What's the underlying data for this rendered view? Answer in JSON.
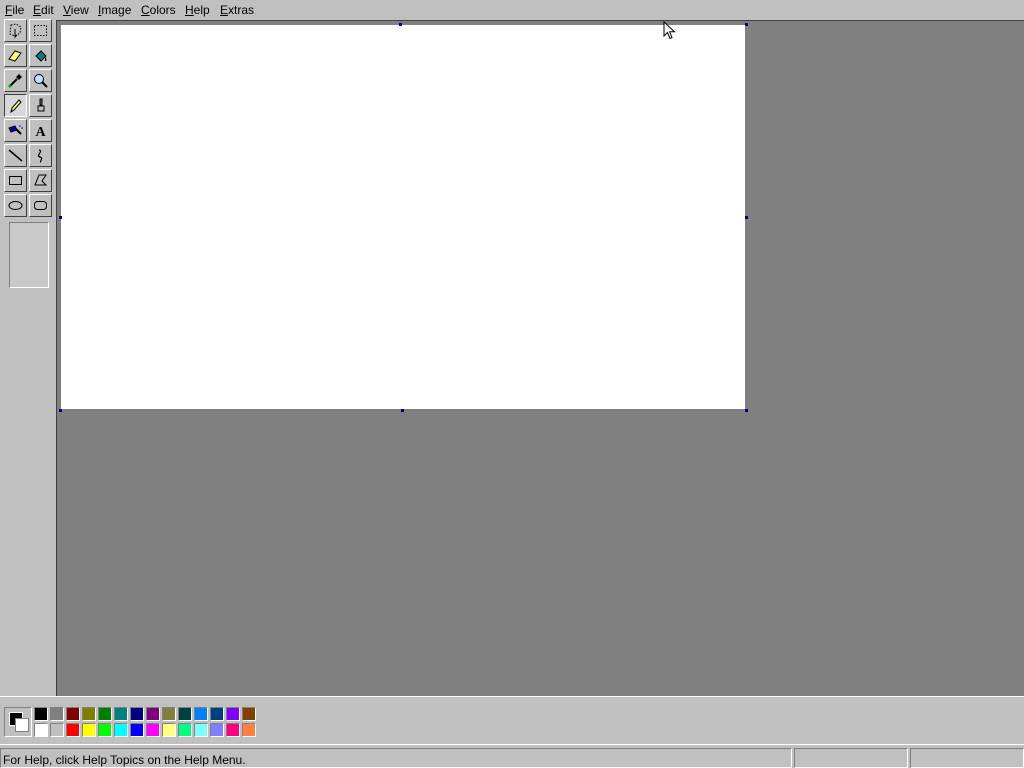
{
  "menu": [
    {
      "id": "file",
      "label": "File"
    },
    {
      "id": "edit",
      "label": "Edit"
    },
    {
      "id": "view",
      "label": "View"
    },
    {
      "id": "image",
      "label": "Image"
    },
    {
      "id": "colors",
      "label": "Colors"
    },
    {
      "id": "help",
      "label": "Help"
    },
    {
      "id": "extras",
      "label": "Extras"
    }
  ],
  "tools": [
    {
      "name": "free-form-select-tool",
      "icon": "free-form-select-icon"
    },
    {
      "name": "rect-select-tool",
      "icon": "rect-select-icon"
    },
    {
      "name": "eraser-tool",
      "icon": "eraser-icon"
    },
    {
      "name": "fill-tool",
      "icon": "paint-bucket-icon"
    },
    {
      "name": "pick-color-tool",
      "icon": "eyedropper-icon"
    },
    {
      "name": "magnifier-tool",
      "icon": "magnifier-icon"
    },
    {
      "name": "pencil-tool",
      "icon": "pencil-icon",
      "selected": true
    },
    {
      "name": "brush-tool",
      "icon": "brush-icon"
    },
    {
      "name": "airbrush-tool",
      "icon": "airbrush-icon"
    },
    {
      "name": "text-tool",
      "icon": "text-icon",
      "glyph": "A"
    },
    {
      "name": "line-tool",
      "icon": "line-icon"
    },
    {
      "name": "curve-tool",
      "icon": "curve-icon"
    },
    {
      "name": "rectangle-tool",
      "icon": "rectangle-icon"
    },
    {
      "name": "polygon-tool",
      "icon": "polygon-icon"
    },
    {
      "name": "ellipse-tool",
      "icon": "ellipse-icon"
    },
    {
      "name": "rounded-rect-tool",
      "icon": "rounded-rectangle-icon"
    }
  ],
  "colors": {
    "foreground": "#000000",
    "background": "#ffffff",
    "palette_top": [
      "#000000",
      "#808080",
      "#800000",
      "#808000",
      "#008000",
      "#008080",
      "#000080",
      "#800080",
      "#808040",
      "#004040",
      "#0080ff",
      "#004080",
      "#8000ff",
      "#804000"
    ],
    "palette_bottom": [
      "#ffffff",
      "#c0c0c0",
      "#ff0000",
      "#ffff00",
      "#00ff00",
      "#00ffff",
      "#0000ff",
      "#ff00ff",
      "#ffff80",
      "#00ff80",
      "#80ffff",
      "#8080ff",
      "#ff0080",
      "#ff8040"
    ]
  },
  "status": {
    "help_text": "For Help, click Help Topics on the Help Menu.",
    "coordinates": "",
    "size": ""
  }
}
